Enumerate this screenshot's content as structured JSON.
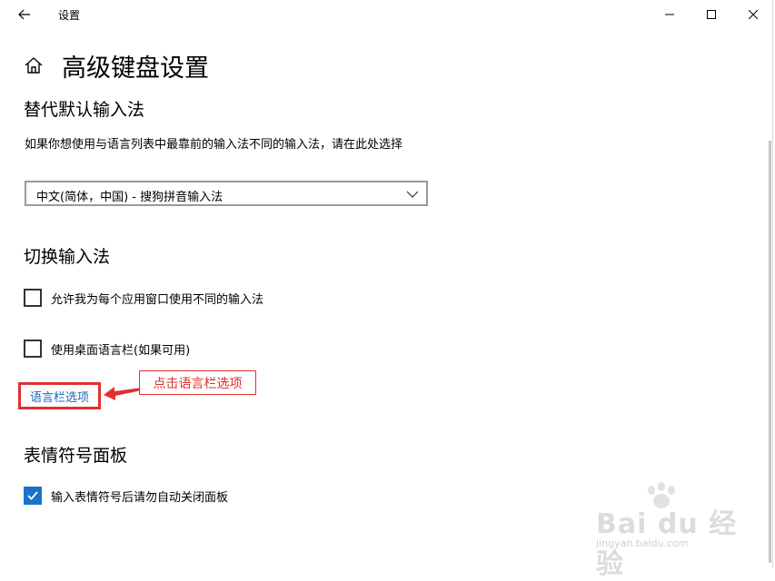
{
  "window": {
    "title": "设置"
  },
  "page": {
    "title": "高级键盘设置"
  },
  "default_input": {
    "heading": "替代默认输入法",
    "description": "如果你想使用与语言列表中最靠前的输入法不同的输入法，请在此处选择",
    "selected_value": "中文(简体，中国) - 搜狗拼音输入法"
  },
  "switch_input": {
    "heading": "切换输入法",
    "options": [
      {
        "label": "允许我为每个应用窗口使用不同的输入法",
        "checked": false
      },
      {
        "label": "使用桌面语言栏(如果可用)",
        "checked": false
      }
    ],
    "link_label": "语言栏选项"
  },
  "annotation": {
    "callout_text": "点击语言栏选项",
    "color": "#e03030"
  },
  "emoji_panel": {
    "heading": "表情符号面板",
    "option_label": "输入表情符号后请勿自动关闭面板",
    "checked": true
  },
  "watermark": {
    "main": "Bai du 经验",
    "sub": "jingyan.baidu.com"
  },
  "colors": {
    "accent": "#1a73c9",
    "link": "#1769b8"
  }
}
